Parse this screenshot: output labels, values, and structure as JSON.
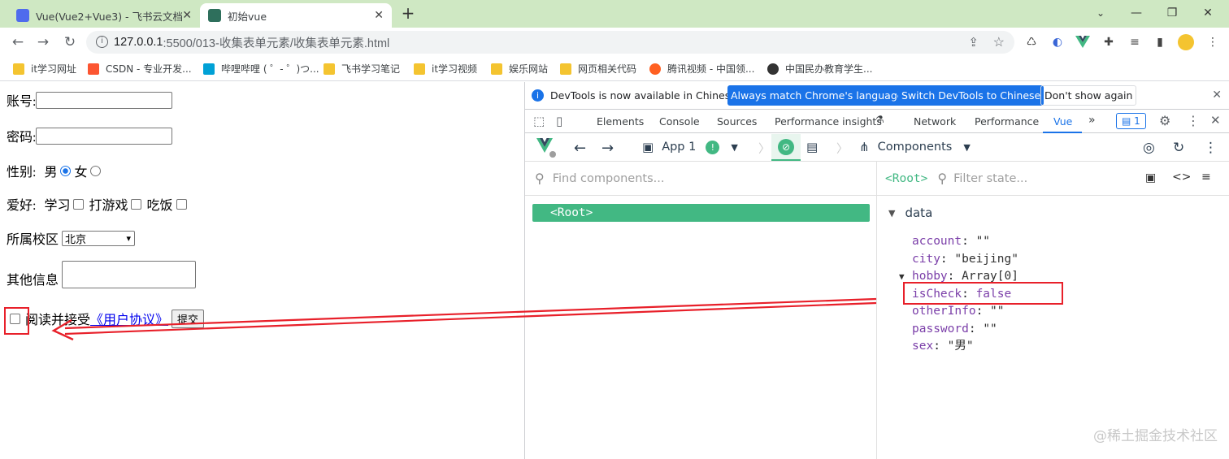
{
  "browser": {
    "tabs": [
      {
        "title": "Vue(Vue2+Vue3) - 飞书云文档",
        "active": false,
        "fav_color": "#4f6bed"
      },
      {
        "title": "初始vue",
        "active": true,
        "fav_color": "#2e6f5c"
      }
    ],
    "new_tab_icon": "plus-icon",
    "url_host": "127.0.0.1",
    "url_path": ":5500/013-收集表单元素/收集表单元素.html",
    "bookmarks": [
      {
        "label": "it学习网址",
        "icon": "folder-icon",
        "color": "#f4c430"
      },
      {
        "label": "CSDN - 专业开发...",
        "icon": "csdn-icon",
        "color": "#fc5531"
      },
      {
        "label": "哔哩哔哩 ( ゜- ゜)つ...",
        "icon": "bilibili-icon",
        "color": "#00a1d6"
      },
      {
        "label": "飞书学习笔记",
        "icon": "folder-icon",
        "color": "#f4c430"
      },
      {
        "label": "it学习视频",
        "icon": "folder-icon",
        "color": "#f4c430"
      },
      {
        "label": "娱乐网站",
        "icon": "folder-icon",
        "color": "#f4c430"
      },
      {
        "label": "网页相关代码",
        "icon": "folder-icon",
        "color": "#f4c430"
      },
      {
        "label": "腾讯视频 - 中国领...",
        "icon": "tencent-video-icon",
        "color": "#ff6022"
      },
      {
        "label": "中国民办教育学生...",
        "icon": "globe-icon",
        "color": "#333333"
      }
    ]
  },
  "form": {
    "account_label": "账号:",
    "password_label": "密码:",
    "sex_label": "性别:",
    "sex_male": "男",
    "sex_female": "女",
    "hobby_label": "爱好:",
    "hobby_study": "学习",
    "hobby_game": "打游戏",
    "hobby_eat": "吃饭",
    "campus_label": "所属校区",
    "campus_selected": "北京",
    "other_label": "其他信息",
    "agree_text": "阅读并接受",
    "agree_link": "《用户协议》",
    "submit_label": "提交"
  },
  "devtools": {
    "info_text": "DevTools is now available in Chinese!",
    "btn_match": "Always match Chrome's language",
    "btn_switch": "Switch DevTools to Chinese",
    "btn_dont_show": "Don't show again",
    "tabs": [
      "Elements",
      "Console",
      "Sources",
      "Performance insights",
      "Network",
      "Performance",
      "Vue"
    ],
    "active_tab": "Vue",
    "issues_count": "1",
    "vue": {
      "app_label": "App 1",
      "components_label": "Components",
      "find_placeholder": "Find components...",
      "root_node": "<Root>",
      "selected_label": "<Root>",
      "filter_placeholder": "Filter state...",
      "section": "data",
      "state": [
        {
          "key": "account",
          "value": "\"\""
        },
        {
          "key": "city",
          "value": "\"beijing\""
        },
        {
          "key": "hobby",
          "value": "Array[0]"
        },
        {
          "key": "isCheck",
          "value": "false"
        },
        {
          "key": "otherInfo",
          "value": "\"\""
        },
        {
          "key": "password",
          "value": "\"\""
        },
        {
          "key": "sex",
          "value": "\"男\""
        }
      ]
    }
  },
  "watermark": "@稀土掘金技术社区",
  "colors": {
    "tabstrip": "#cfe8c3",
    "vue_green": "#42b883",
    "highlight_red": "#e8202a",
    "devtools_blue": "#1a73e8"
  }
}
